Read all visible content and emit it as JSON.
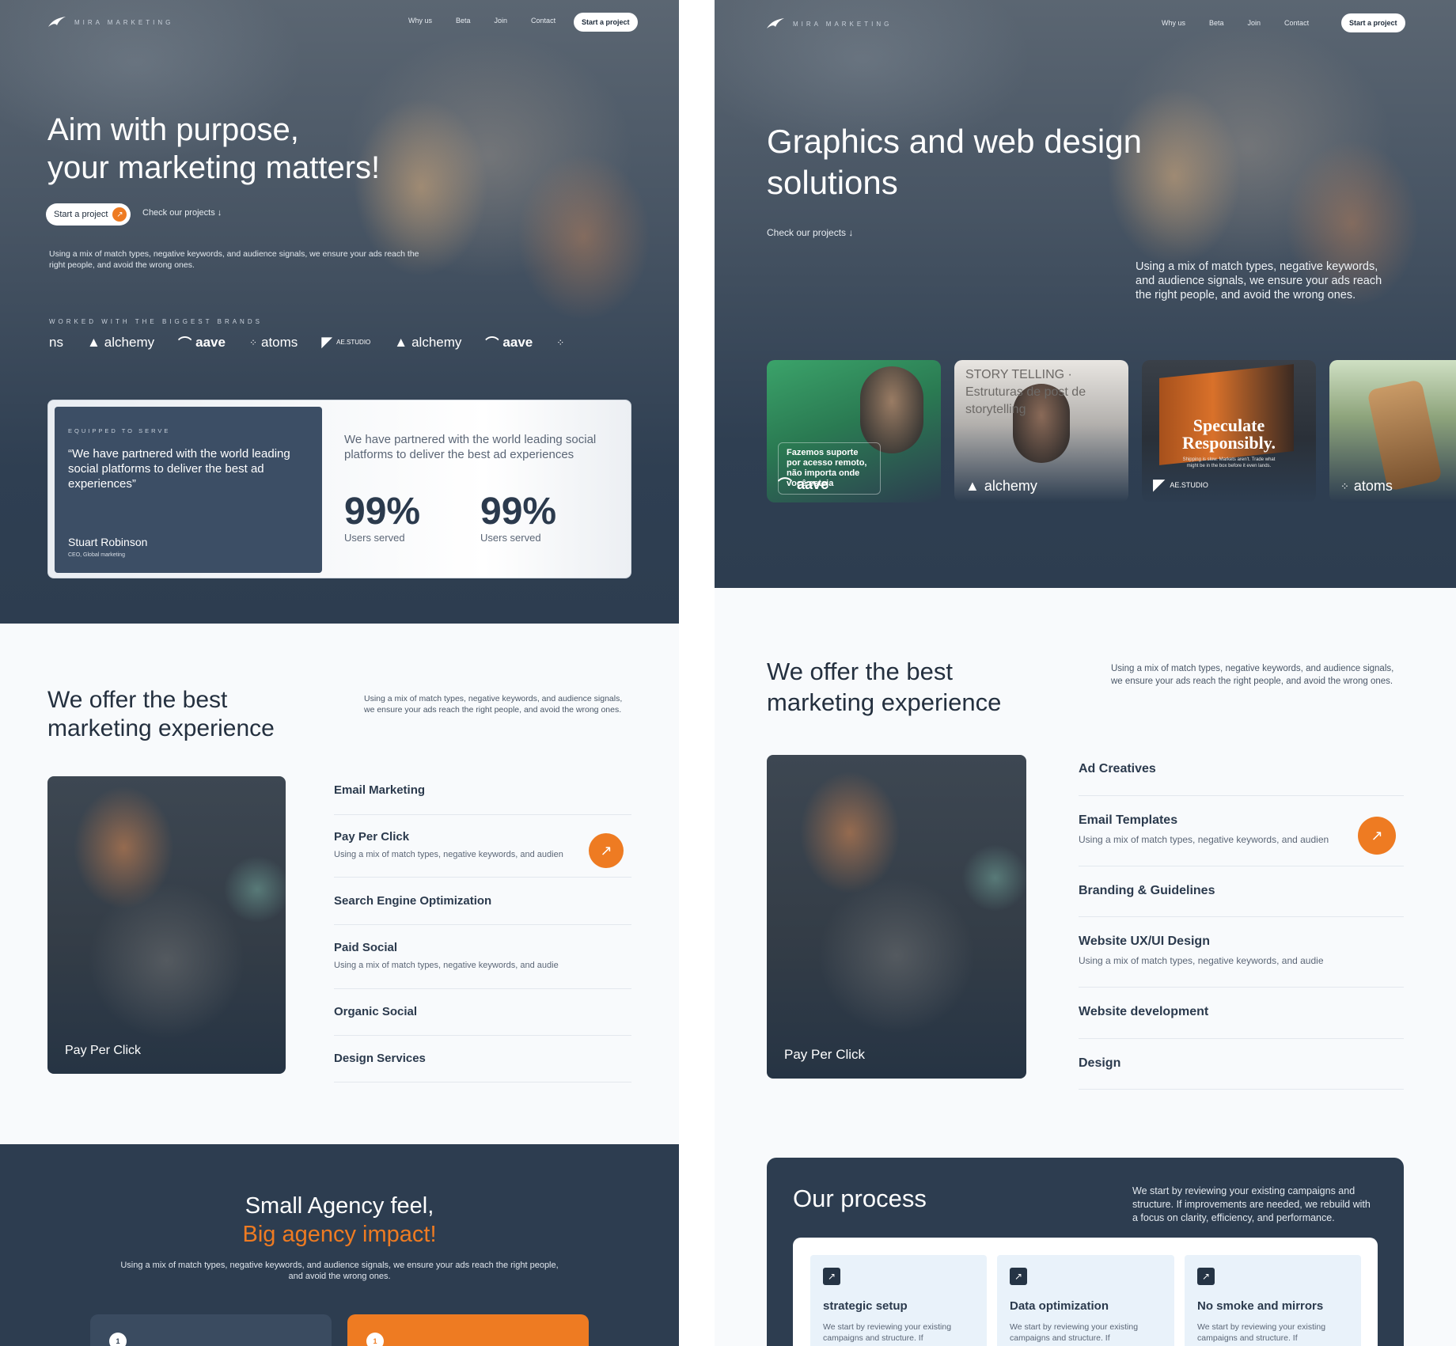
{
  "brand": {
    "name": "MIRA MARKETING"
  },
  "nav": {
    "items": [
      "Why us",
      "Beta",
      "Join",
      "Contact"
    ],
    "cta": "Start a project"
  },
  "left": {
    "hero": {
      "title_line1": "Aim with purpose,",
      "title_line2": "your marketing matters!",
      "primary_button": "Start a project",
      "secondary_link": "Check our projects",
      "description": "Using a mix of match types, negative keywords, and audience signals, we ensure your ads reach the right people, and avoid the wrong ones.",
      "brands_label": "WORKED WITH THE BIGGEST BRANDS",
      "brands": [
        "ns",
        "alchemy",
        "aave",
        "atoms",
        "AE.STUDIO",
        "alchemy",
        "aave"
      ]
    },
    "testimonial": {
      "eyebrow": "EQUIPPED TO SERVE",
      "quote": "“We have partnered with the world leading social platforms to deliver the best ad experiences”",
      "author": "Stuart Robinson",
      "role": "CEO, Global marketing",
      "statement": "We have partnered with the world leading social platforms to deliver the best ad experiences",
      "stats": [
        {
          "value": "99%",
          "label": "Users served"
        },
        {
          "value": "99%",
          "label": "Users served"
        }
      ]
    },
    "services": {
      "title_line1": "We offer the best",
      "title_line2": "marketing experience",
      "description": "Using a mix of match types, negative keywords, and audience signals, we ensure your ads reach the right people, and avoid the wrong ones.",
      "image_label": "Pay Per Click",
      "items": [
        {
          "title": "Email Marketing",
          "desc": ""
        },
        {
          "title": "Pay Per Click",
          "desc": "Using a mix of match types, negative keywords, and audien"
        },
        {
          "title": "Search Engine Optimization",
          "desc": ""
        },
        {
          "title": "Paid Social",
          "desc": "Using a mix of match types, negative keywords, and audie"
        },
        {
          "title": "Organic Social",
          "desc": ""
        },
        {
          "title": "Design Services",
          "desc": ""
        }
      ]
    },
    "agency": {
      "line1": "Small Agency feel,",
      "line2": "Big agency impact!",
      "description": "Using a mix of match types, negative keywords, and audience signals, we ensure your ads reach the right people, and avoid the wrong ones.",
      "steps": [
        "1",
        "1"
      ]
    }
  },
  "right": {
    "hero": {
      "title_line1": "Graphics and web design",
      "title_line2": "solutions",
      "secondary_link": "Check our projects",
      "description": "Using a mix of match types, negative keywords, and audience signals, we ensure your ads reach the right people, and avoid the wrong ones."
    },
    "projects": [
      {
        "brand": "aave",
        "overlay": "Fazemos suporte por acesso remoto, não importa onde você esteja"
      },
      {
        "brand": "alchemy",
        "overlay": "STORY TELLING · Estruturas de post de storytelling"
      },
      {
        "brand": "AE.STUDIO",
        "overlay": "Speculate Responsibly.",
        "sub": "Shipping is slow. Markets aren't. Trade what might be in the box before it even lands."
      },
      {
        "brand": "atoms",
        "overlay": ""
      }
    ],
    "services": {
      "title_line1": "We offer the best",
      "title_line2": "marketing experience",
      "description": "Using a mix of match types, negative keywords, and audience signals, we ensure your ads reach the right people, and avoid the wrong ones.",
      "image_label": "Pay Per Click",
      "items": [
        {
          "title": "Ad Creatives",
          "desc": ""
        },
        {
          "title": "Email Templates",
          "desc": "Using a mix of match types, negative keywords, and audien"
        },
        {
          "title": "Branding & Guidelines",
          "desc": ""
        },
        {
          "title": "Website UX/UI Design",
          "desc": "Using a mix of match types, negative keywords, and audie"
        },
        {
          "title": "Website development",
          "desc": ""
        },
        {
          "title": "Design",
          "desc": ""
        }
      ]
    },
    "process": {
      "title": "Our process",
      "description": "We start by reviewing your existing campaigns and structure. If improvements are needed, we rebuild with a focus on clarity, efficiency, and performance.",
      "cards": [
        {
          "title": "strategic setup",
          "desc": "We start by reviewing your existing campaigns and structure. If"
        },
        {
          "title": "Data optimization",
          "desc": "We start by reviewing your existing campaigns and structure. If"
        },
        {
          "title": "No smoke and mirrors",
          "desc": "We start by reviewing your existing campaigns and structure. If"
        }
      ]
    }
  },
  "colors": {
    "navy": "#2d3d50",
    "orange": "#ee7b22",
    "light": "#f8fafc",
    "pale_blue": "#e9f2fa"
  }
}
